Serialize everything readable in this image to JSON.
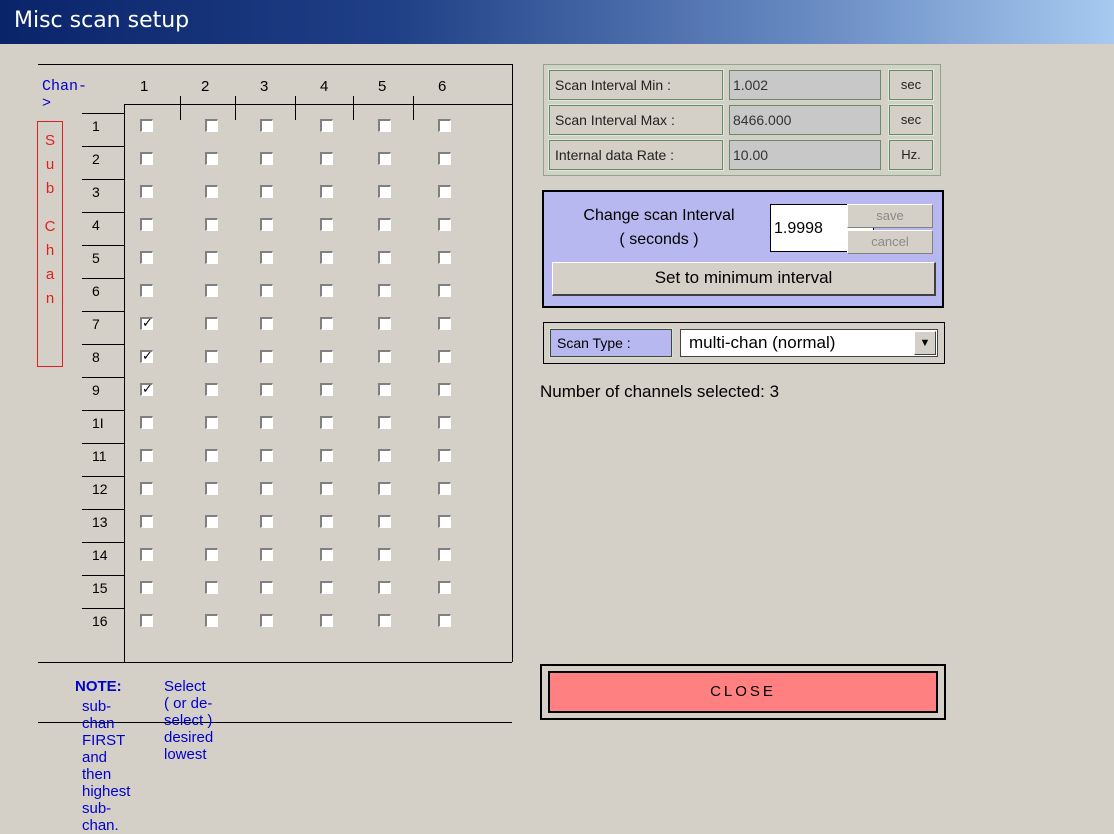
{
  "window": {
    "title": "Misc scan setup"
  },
  "grid": {
    "chan_label": "Chan->",
    "columns": [
      "1",
      "2",
      "3",
      "4",
      "5",
      "6"
    ],
    "rows": [
      "1",
      "2",
      "3",
      "4",
      "5",
      "6",
      "7",
      "8",
      "9",
      "1I",
      "11",
      "12",
      "13",
      "14",
      "15",
      "16"
    ],
    "sub_chan_label": [
      "S",
      "u",
      "b",
      "C",
      "h",
      "a",
      "n"
    ],
    "checked": [
      [
        7,
        1
      ],
      [
        8,
        1
      ],
      [
        9,
        1
      ]
    ],
    "note_label": "NOTE:",
    "note_line1": "Select ( or de-select ) desired lowest",
    "note_line2": "sub-chan  FIRST and then highest sub-chan."
  },
  "info": {
    "scan_interval_min": {
      "label": "Scan Interval Min :",
      "value": "1.002",
      "unit": "sec"
    },
    "scan_interval_max": {
      "label": "Scan Interval Max :",
      "value": "8466.000",
      "unit": "sec"
    },
    "internal_data_rate": {
      "label": "Internal data Rate :",
      "value": "10.00",
      "unit": "Hz."
    }
  },
  "change_interval": {
    "title_line1": "Change scan Interval",
    "title_line2": "( seconds )",
    "value": "1.9998",
    "save_label": "save",
    "cancel_label": "cancel",
    "min_button_label": "Set to minimum interval"
  },
  "scan_type": {
    "label": "Scan Type :",
    "selected": "multi-chan (normal)"
  },
  "status": {
    "channels_selected": "Number of channels selected:  3"
  },
  "close_button_label": "CLOSE",
  "colors": {
    "panel_bg": "#d4d0c8",
    "accent_panel": "#b8b8f0",
    "close_bg": "#ff8080",
    "note_blue": "#0000cc",
    "sub_chan_red": "#e02020"
  }
}
